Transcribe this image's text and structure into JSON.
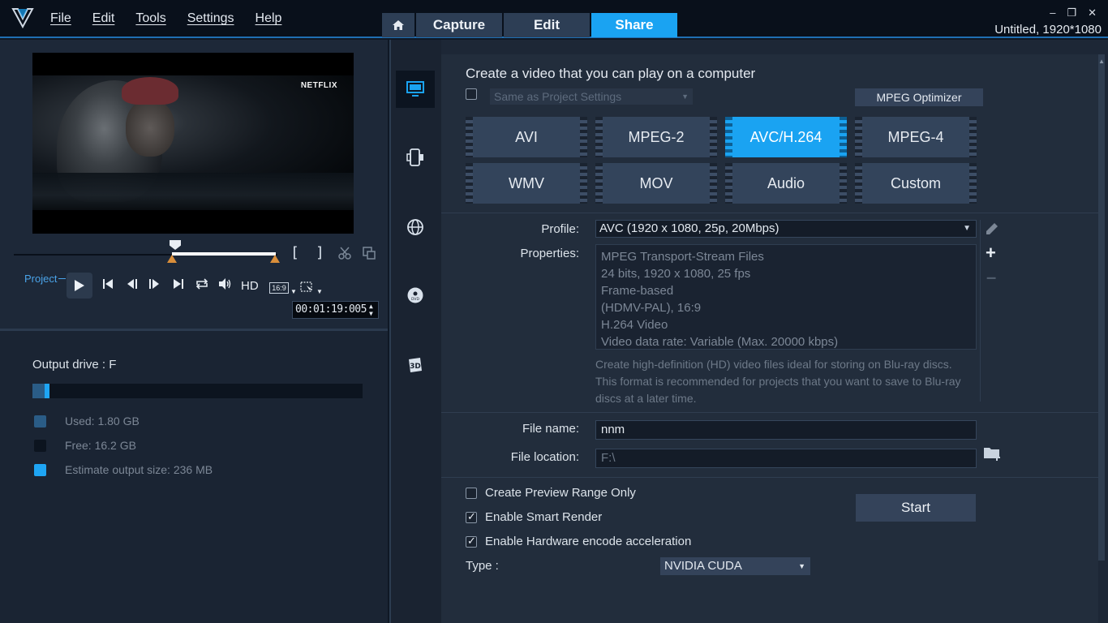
{
  "menu": [
    "File",
    "Edit",
    "Tools",
    "Settings",
    "Help"
  ],
  "tabs": {
    "capture": "Capture",
    "edit": "Edit",
    "share": "Share"
  },
  "window": {
    "title": "Untitled, 1920*1080",
    "minimize": "–",
    "restore": "❐",
    "close": "✕"
  },
  "preview": {
    "watermark": "NETFLIX",
    "project_label": "Project",
    "hd_label": "HD",
    "ratio_label": "16:9",
    "timecode": "00:01:19:005",
    "trim_in": "[",
    "trim_out": "]"
  },
  "output": {
    "drive_label": "Output drive : F",
    "used_label": "Used:  1.80 GB",
    "free_label": "Free:  16.2 GB",
    "estimate_label": "Estimate output size:  236 MB",
    "colors": {
      "used": "#2a5c86",
      "free": "#141c28",
      "estimate": "#1ea5f4"
    }
  },
  "share": {
    "heading": "Create a video that you can play on a computer",
    "same_as_project": "Same as Project Settings",
    "mpeg_optimizer": "MPEG Optimizer",
    "formats": [
      "AVI",
      "MPEG-2",
      "AVC/H.264",
      "MPEG-4",
      "WMV",
      "MOV",
      "Audio",
      "Custom"
    ],
    "selected_format": "AVC/H.264",
    "profile_label": "Profile:",
    "profile_value": "AVC (1920 x 1080, 25p, 20Mbps)",
    "properties_label": "Properties:",
    "properties": [
      "MPEG Transport-Stream Files",
      "24 bits, 1920 x 1080, 25 fps",
      "Frame-based",
      "(HDMV-PAL),  16:9",
      "H.264 Video",
      "Video data rate: Variable (Max. 20000 kbps)"
    ],
    "description": "Create high-definition (HD) video files ideal for storing on Blu-ray discs. This format is recommended for projects that you want to save to Blu-ray discs at a later time.",
    "file_name_label": "File name:",
    "file_name_value": "nnm",
    "file_location_label": "File location:",
    "file_location_value": "F:\\",
    "options": [
      {
        "label": "Create Preview Range Only",
        "checked": false
      },
      {
        "label": "Enable Smart Render",
        "checked": true
      },
      {
        "label": "Enable Hardware encode acceleration",
        "checked": true
      }
    ],
    "start_label": "Start",
    "type_label": "Type :",
    "type_value": "NVIDIA CUDA"
  },
  "accent_color": "#1aa3f2"
}
